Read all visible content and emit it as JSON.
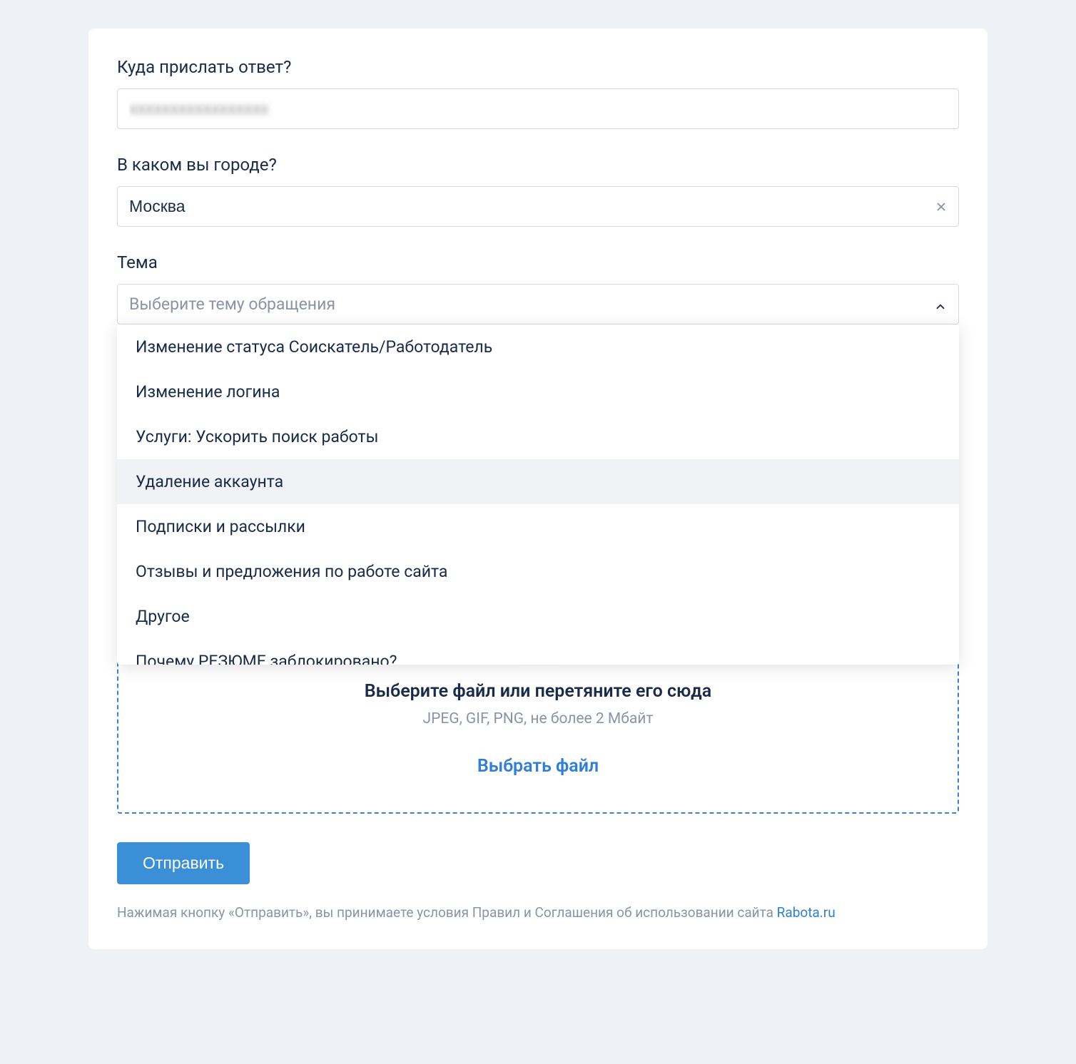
{
  "form": {
    "email_label": "Куда прислать ответ?",
    "email_value": "xxxxxxxxxxxxxxxxx",
    "city_label": "В каком вы городе?",
    "city_value": "Москва",
    "topic_label": "Тема",
    "topic_placeholder": "Выберите тему обращения"
  },
  "topic_options": [
    {
      "label": "Изменение статуса Соискатель/Работодатель",
      "highlighted": false
    },
    {
      "label": "Изменение логина",
      "highlighted": false
    },
    {
      "label": "Услуги: Ускорить поиск работы",
      "highlighted": false
    },
    {
      "label": "Удаление аккаунта",
      "highlighted": true
    },
    {
      "label": "Подписки и рассылки",
      "highlighted": false
    },
    {
      "label": "Отзывы и предложения по работе сайта",
      "highlighted": false
    },
    {
      "label": "Другое",
      "highlighted": false
    },
    {
      "label": "Почему РЕЗЮМЕ заблокировано?",
      "highlighted": false,
      "partial": true
    }
  ],
  "dropzone": {
    "title": "Выберите файл или перетяните его сюда",
    "hint": "JPEG, GIF, PNG, не более 2 Мбайт",
    "link": "Выбрать файл"
  },
  "submit_label": "Отправить",
  "legal": {
    "text": "Нажимая кнопку «Отправить», вы принимаете условия Правил и Соглашения об использовании сайта ",
    "link": "Rabota.ru"
  }
}
